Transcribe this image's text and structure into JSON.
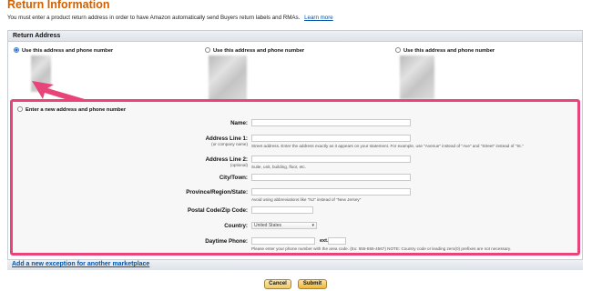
{
  "page": {
    "title": "Return Information",
    "intro": "You must enter a product return address in order to have Amazon automatically send Buyers return labels and RMAs.",
    "learn_more": "Learn more"
  },
  "return_address": {
    "header": "Return Address",
    "choices": [
      {
        "label": "Use this address and phone number",
        "selected": true
      },
      {
        "label": "Use this address and phone number",
        "selected": false
      },
      {
        "label": "Use this address and phone number",
        "selected": false
      }
    ],
    "new_address": {
      "option_label": "Enter a new address and phone number",
      "fields": {
        "name": {
          "label": "Name:"
        },
        "address1": {
          "label": "Address Line 1:",
          "sub": "(or company name)",
          "hint": "Street address. Enter the address exactly as it appears on your statement. For example, use \"Avenue\" instead of \"Ave\" and \"Street\" instead of \"St.\""
        },
        "address2": {
          "label": "Address Line 2:",
          "sub": "(optional)",
          "hint": "Suite, unit, building, floor, etc."
        },
        "city": {
          "label": "City/Town:"
        },
        "state": {
          "label": "Province/Region/State:",
          "hint": "Avoid using abbreviations like \"NJ\" instead of \"New Jersey\""
        },
        "zip": {
          "label": "Postal Code/Zip Code:"
        },
        "country": {
          "label": "Country:",
          "value": "United States"
        },
        "phone": {
          "label": "Daytime Phone:",
          "ext_label": "ext.",
          "hint": "Please enter your phone number with the area code. (Ex: 555-555-4567) NOTE: Country code or leading zero(0) prefixes are not necessary."
        }
      }
    }
  },
  "exception_link": "Add a new exception for another marketplace",
  "buttons": {
    "cancel": "Cancel",
    "submit": "Submit"
  },
  "colors": {
    "title": "#d06000",
    "highlight": "#e8447a",
    "link": "#0055aa"
  }
}
